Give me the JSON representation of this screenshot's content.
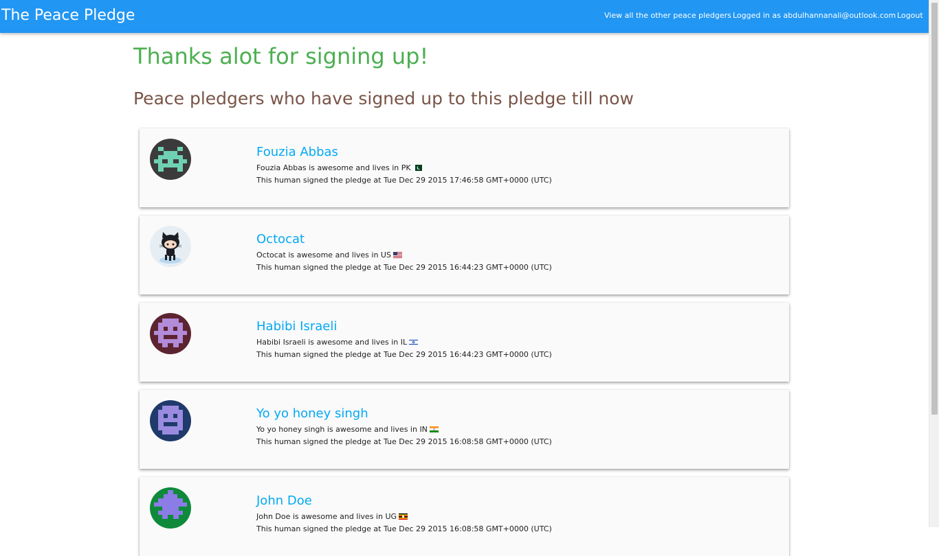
{
  "navbar": {
    "brand": "The Peace Pledge",
    "links": {
      "view_all": "View all the other peace pledgers",
      "logged_in": "Logged in as abdulhannanali@outlook.com",
      "logout": "Logout"
    },
    "color": "#2196f3"
  },
  "main": {
    "thanks_heading": "Thanks alot for signing up!",
    "list_heading": "Peace pledgers who have signed up to this pledge till now"
  },
  "colors": {
    "thanks": "#4caf50",
    "list_heading": "#795548",
    "name_link": "#03a9f4"
  },
  "pledgers": [
    {
      "name": "Fouzia Abbas",
      "desc": "Fouzia Abbas is awesome and lives in PK",
      "signed": "This human signed the pledge at Tue Dec 29 2015 17:46:58 GMT+0000 (UTC)",
      "country": "PK",
      "avatar_icon": "identicon-avatar-icon",
      "avatar_bg": "#3b3b3b",
      "avatar_fg": "#6fd1b3"
    },
    {
      "name": "Octocat",
      "desc": "Octocat is awesome and lives in US",
      "signed": "This human signed the pledge at Tue Dec 29 2015 16:44:23 GMT+0000 (UTC)",
      "country": "US",
      "avatar_icon": "octocat-avatar-icon",
      "avatar_bg": "#e6eef4",
      "avatar_fg": "#1b1f23"
    },
    {
      "name": "Habibi Israeli",
      "desc": "Habibi Israeli is awesome and lives in IL",
      "signed": "This human signed the pledge at Tue Dec 29 2015 16:44:23 GMT+0000 (UTC)",
      "country": "IL",
      "avatar_icon": "identicon-avatar-icon",
      "avatar_bg": "#5c2430",
      "avatar_fg": "#b28bd9"
    },
    {
      "name": "Yo yo honey singh",
      "desc": "Yo yo honey singh is awesome and lives in IN",
      "signed": "This human signed the pledge at Tue Dec 29 2015 16:08:58 GMT+0000 (UTC)",
      "country": "IN",
      "avatar_icon": "identicon-avatar-icon",
      "avatar_bg": "#1f3a6b",
      "avatar_fg": "#9a8be0"
    },
    {
      "name": "John Doe",
      "desc": "John Doe is awesome and lives in UG",
      "signed": "This human signed the pledge at Tue Dec 29 2015 16:08:58 GMT+0000 (UTC)",
      "country": "UG",
      "avatar_icon": "identicon-avatar-icon",
      "avatar_bg": "#0e8a3a",
      "avatar_fg": "#8b7ce6"
    }
  ]
}
